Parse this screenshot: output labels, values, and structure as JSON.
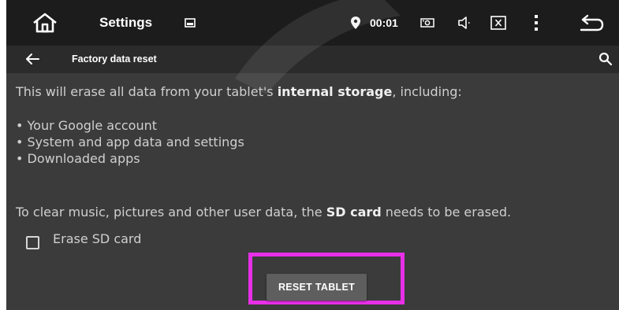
{
  "status_bar": {
    "title": "Settings",
    "time": "00:01",
    "icons": [
      "home-icon",
      "image-icon",
      "location-pin-icon",
      "camera-icon",
      "volume-icon",
      "close-box-icon",
      "more-vert-icon",
      "back-return-icon"
    ]
  },
  "app_bar": {
    "title": "Factory data reset",
    "icons": [
      "back-arrow-icon",
      "search-icon"
    ]
  },
  "content": {
    "intro_pre": "This will erase all data from your tablet's ",
    "intro_bold": "internal storage",
    "intro_post": ", including:",
    "bullets": [
      "• Your Google account",
      "• System and app data and settings",
      "• Downloaded apps"
    ],
    "sd_pre": "To clear music, pictures and other user data, the ",
    "sd_bold": "SD card",
    "sd_post": " needs to be erased.",
    "erase_sd_label": "Erase SD card",
    "erase_sd_checked": false,
    "reset_button": "RESET TABLET"
  },
  "colors": {
    "status_bar_bg": "#1c1c1c",
    "app_bar_bg": "#2b2b2b",
    "content_bg": "#3b3b3b",
    "highlight": "#e82fe8",
    "button_bg": "#5e5e5e"
  }
}
